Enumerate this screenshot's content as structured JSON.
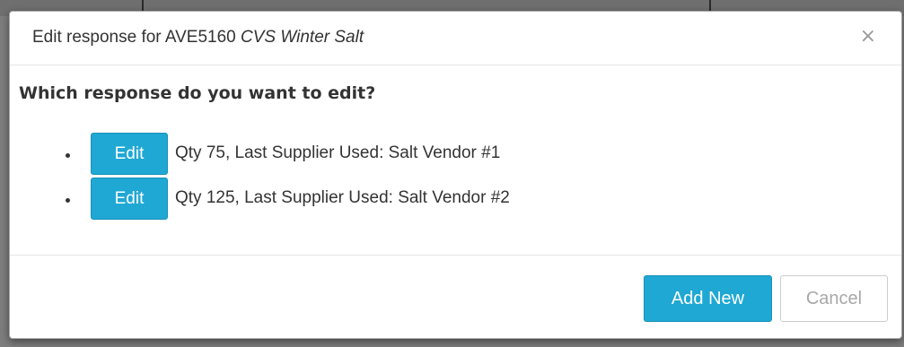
{
  "modal": {
    "title_prefix": "Edit response for AVE5160 ",
    "title_item": "CVS Winter Salt",
    "close_glyph": "×"
  },
  "body": {
    "question": "Which response do you want to edit?",
    "responses": [
      {
        "edit_label": "Edit",
        "text": "Qty 75, Last Supplier Used: Salt Vendor #1"
      },
      {
        "edit_label": "Edit",
        "text": "Qty 125, Last Supplier Used: Salt Vendor #2"
      }
    ]
  },
  "footer": {
    "add_new_label": "Add New",
    "cancel_label": "Cancel"
  },
  "colors": {
    "primary_button": "#1fa8d4",
    "backdrop": "#7d7d7d"
  }
}
